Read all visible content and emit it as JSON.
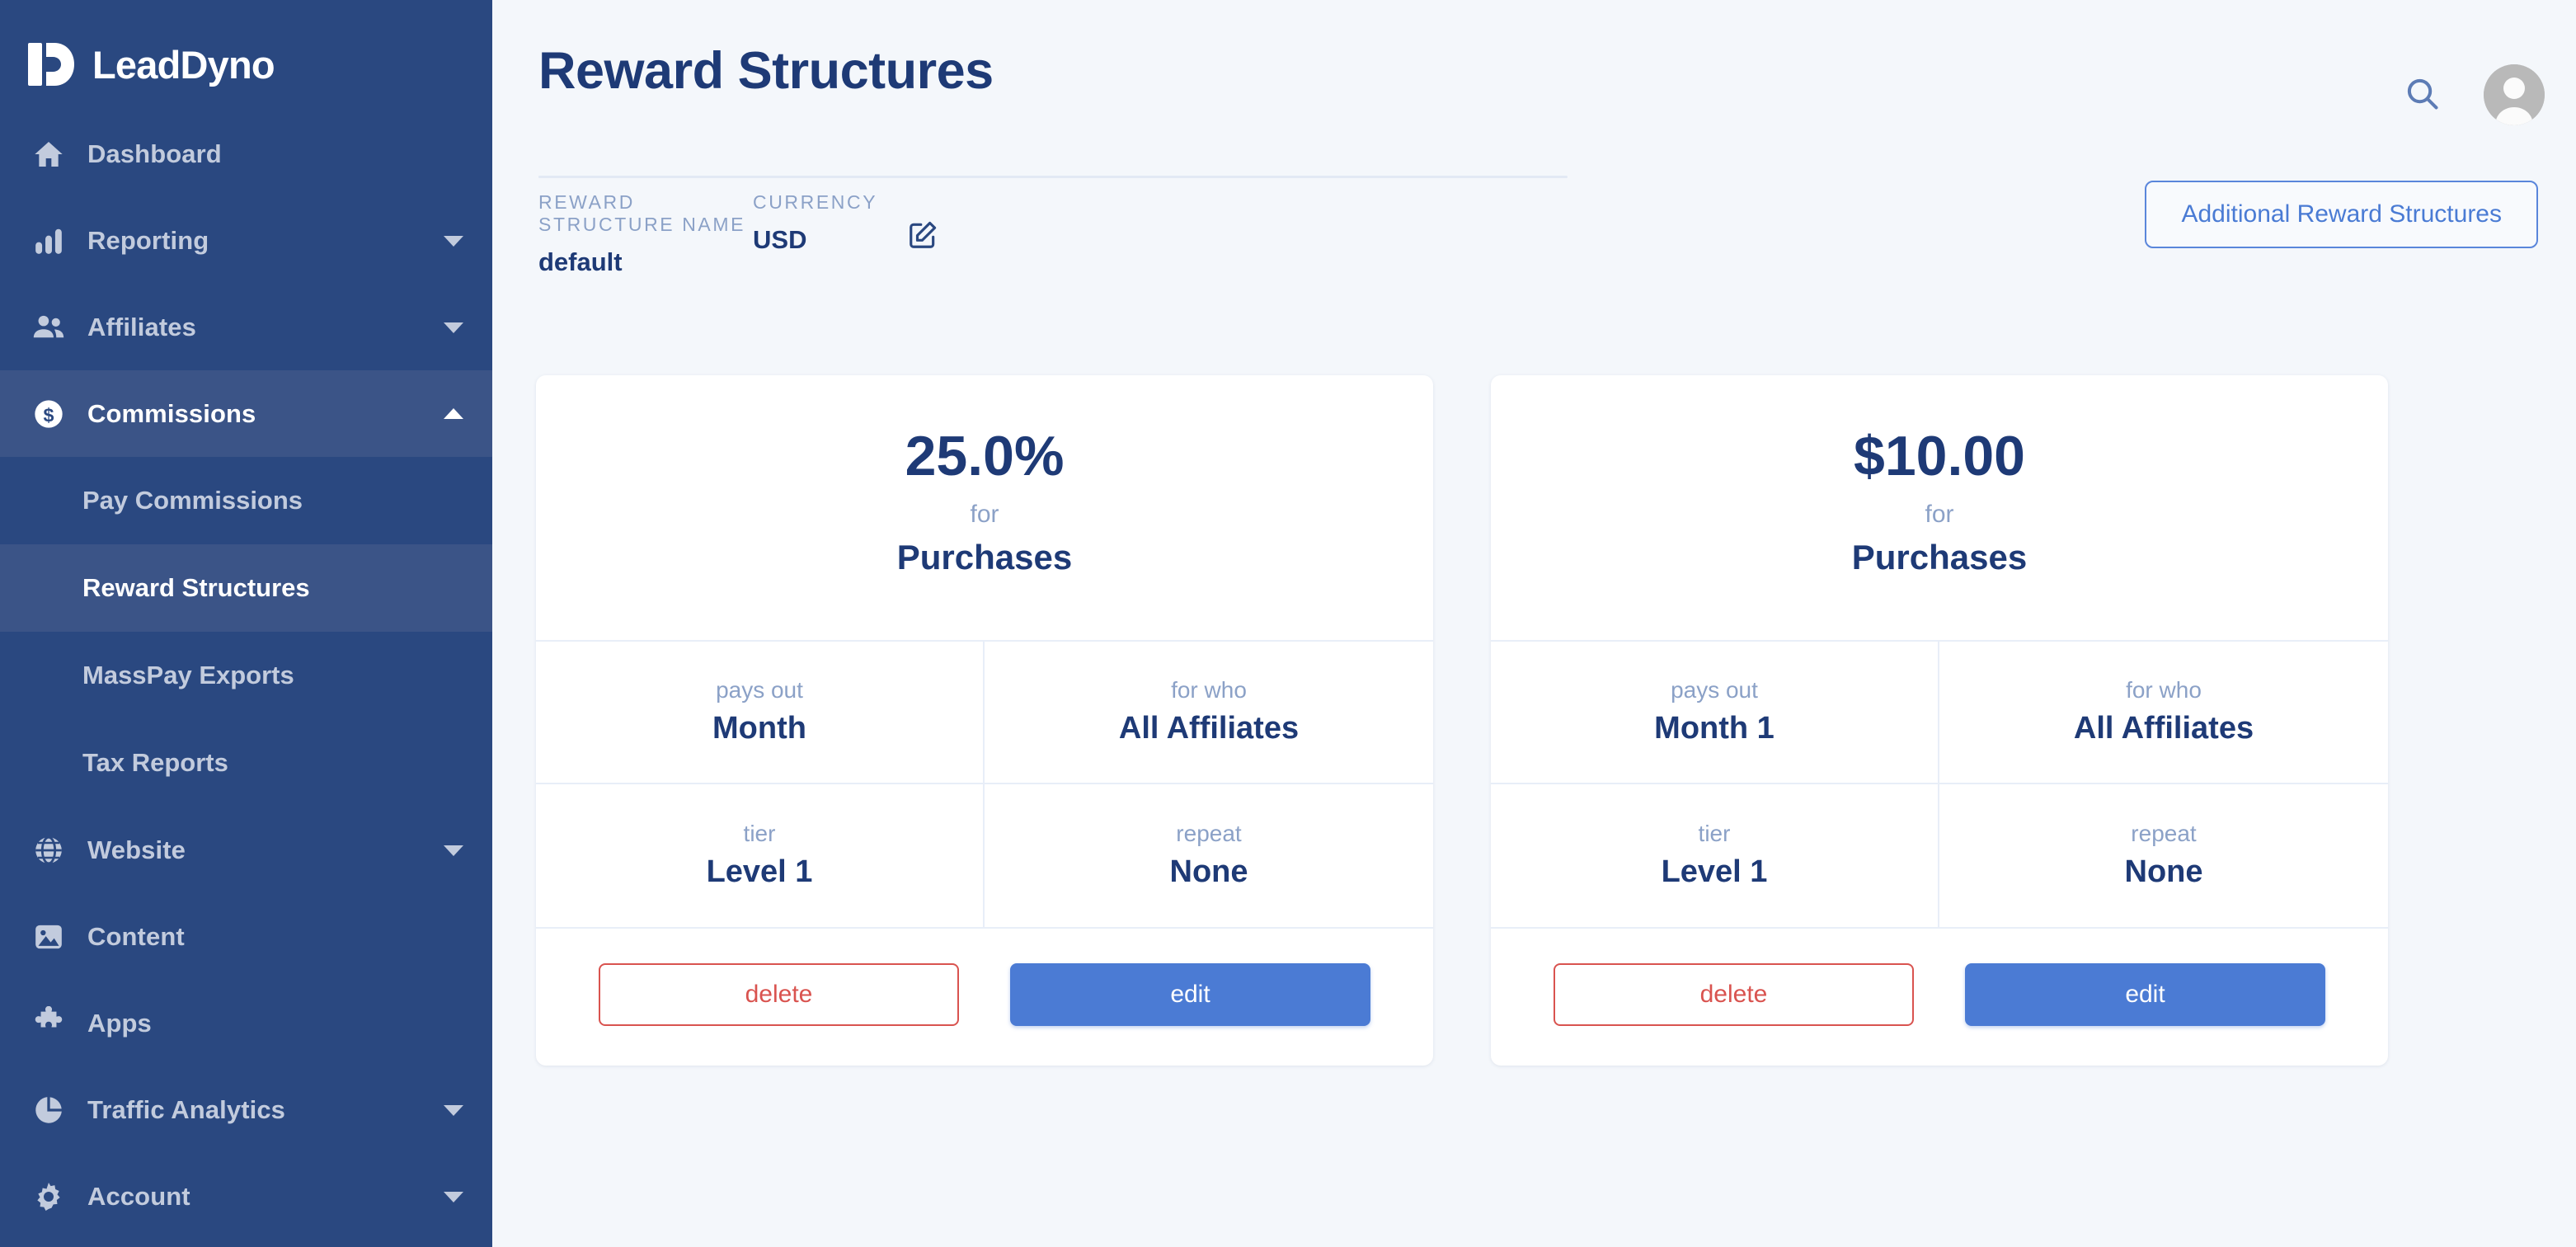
{
  "brand": {
    "name": "LeadDyno",
    "logo_icon": "leaddyno-logo-icon"
  },
  "sidebar": {
    "items": [
      {
        "label": "Dashboard",
        "icon": "home-icon",
        "caret": false,
        "active": false
      },
      {
        "label": "Reporting",
        "icon": "bar-chart-icon",
        "caret": "down",
        "active": false
      },
      {
        "label": "Affiliates",
        "icon": "users-icon",
        "caret": "down",
        "active": false
      },
      {
        "label": "Commissions",
        "icon": "dollar-circle-icon",
        "caret": "up",
        "active": true
      },
      {
        "label": "Website",
        "icon": "globe-icon",
        "caret": "down",
        "active": false
      },
      {
        "label": "Content",
        "icon": "image-icon",
        "caret": false,
        "active": false
      },
      {
        "label": "Apps",
        "icon": "puzzle-icon",
        "caret": false,
        "active": false
      },
      {
        "label": "Traffic Analytics",
        "icon": "pie-chart-icon",
        "caret": "down",
        "active": false
      },
      {
        "label": "Account",
        "icon": "gear-icon",
        "caret": "down",
        "active": false
      }
    ],
    "commissions_submenu": [
      {
        "label": "Pay Commissions",
        "active": false
      },
      {
        "label": "Reward Structures",
        "active": true
      },
      {
        "label": "MassPay Exports",
        "active": false
      },
      {
        "label": "Tax Reports",
        "active": false
      }
    ]
  },
  "header": {
    "title": "Reward Structures",
    "search_icon": "search-icon",
    "avatar_icon": "user-avatar-icon",
    "additional_button": "Additional Reward Structures",
    "edit_icon": "edit-pencil-square-icon",
    "meta": [
      {
        "label": "REWARD STRUCTURE NAME",
        "value": "default"
      },
      {
        "label": "CURRENCY",
        "value": "USD"
      }
    ]
  },
  "cards": [
    {
      "amount": "25.0%",
      "for_label": "for",
      "type": "Purchases",
      "fields": [
        {
          "label": "pays out",
          "value": "Month"
        },
        {
          "label": "for who",
          "value": "All Affiliates"
        },
        {
          "label": "tier",
          "value": "Level 1"
        },
        {
          "label": "repeat",
          "value": "None"
        }
      ],
      "delete_label": "delete",
      "edit_label": "edit"
    },
    {
      "amount": "$10.00",
      "for_label": "for",
      "type": "Purchases",
      "fields": [
        {
          "label": "pays out",
          "value": "Month 1"
        },
        {
          "label": "for who",
          "value": "All Affiliates"
        },
        {
          "label": "tier",
          "value": "Level 1"
        },
        {
          "label": "repeat",
          "value": "None"
        }
      ],
      "delete_label": "delete",
      "edit_label": "edit"
    }
  ],
  "colors": {
    "sidebar_bg": "#2a4880",
    "sidebar_active": "#3b5487",
    "page_bg": "#f4f7fb",
    "navy_text": "#1e3a76",
    "muted_text": "#8ba1c7",
    "accent_blue": "#4b7bd4",
    "danger_red": "#d9534f"
  }
}
